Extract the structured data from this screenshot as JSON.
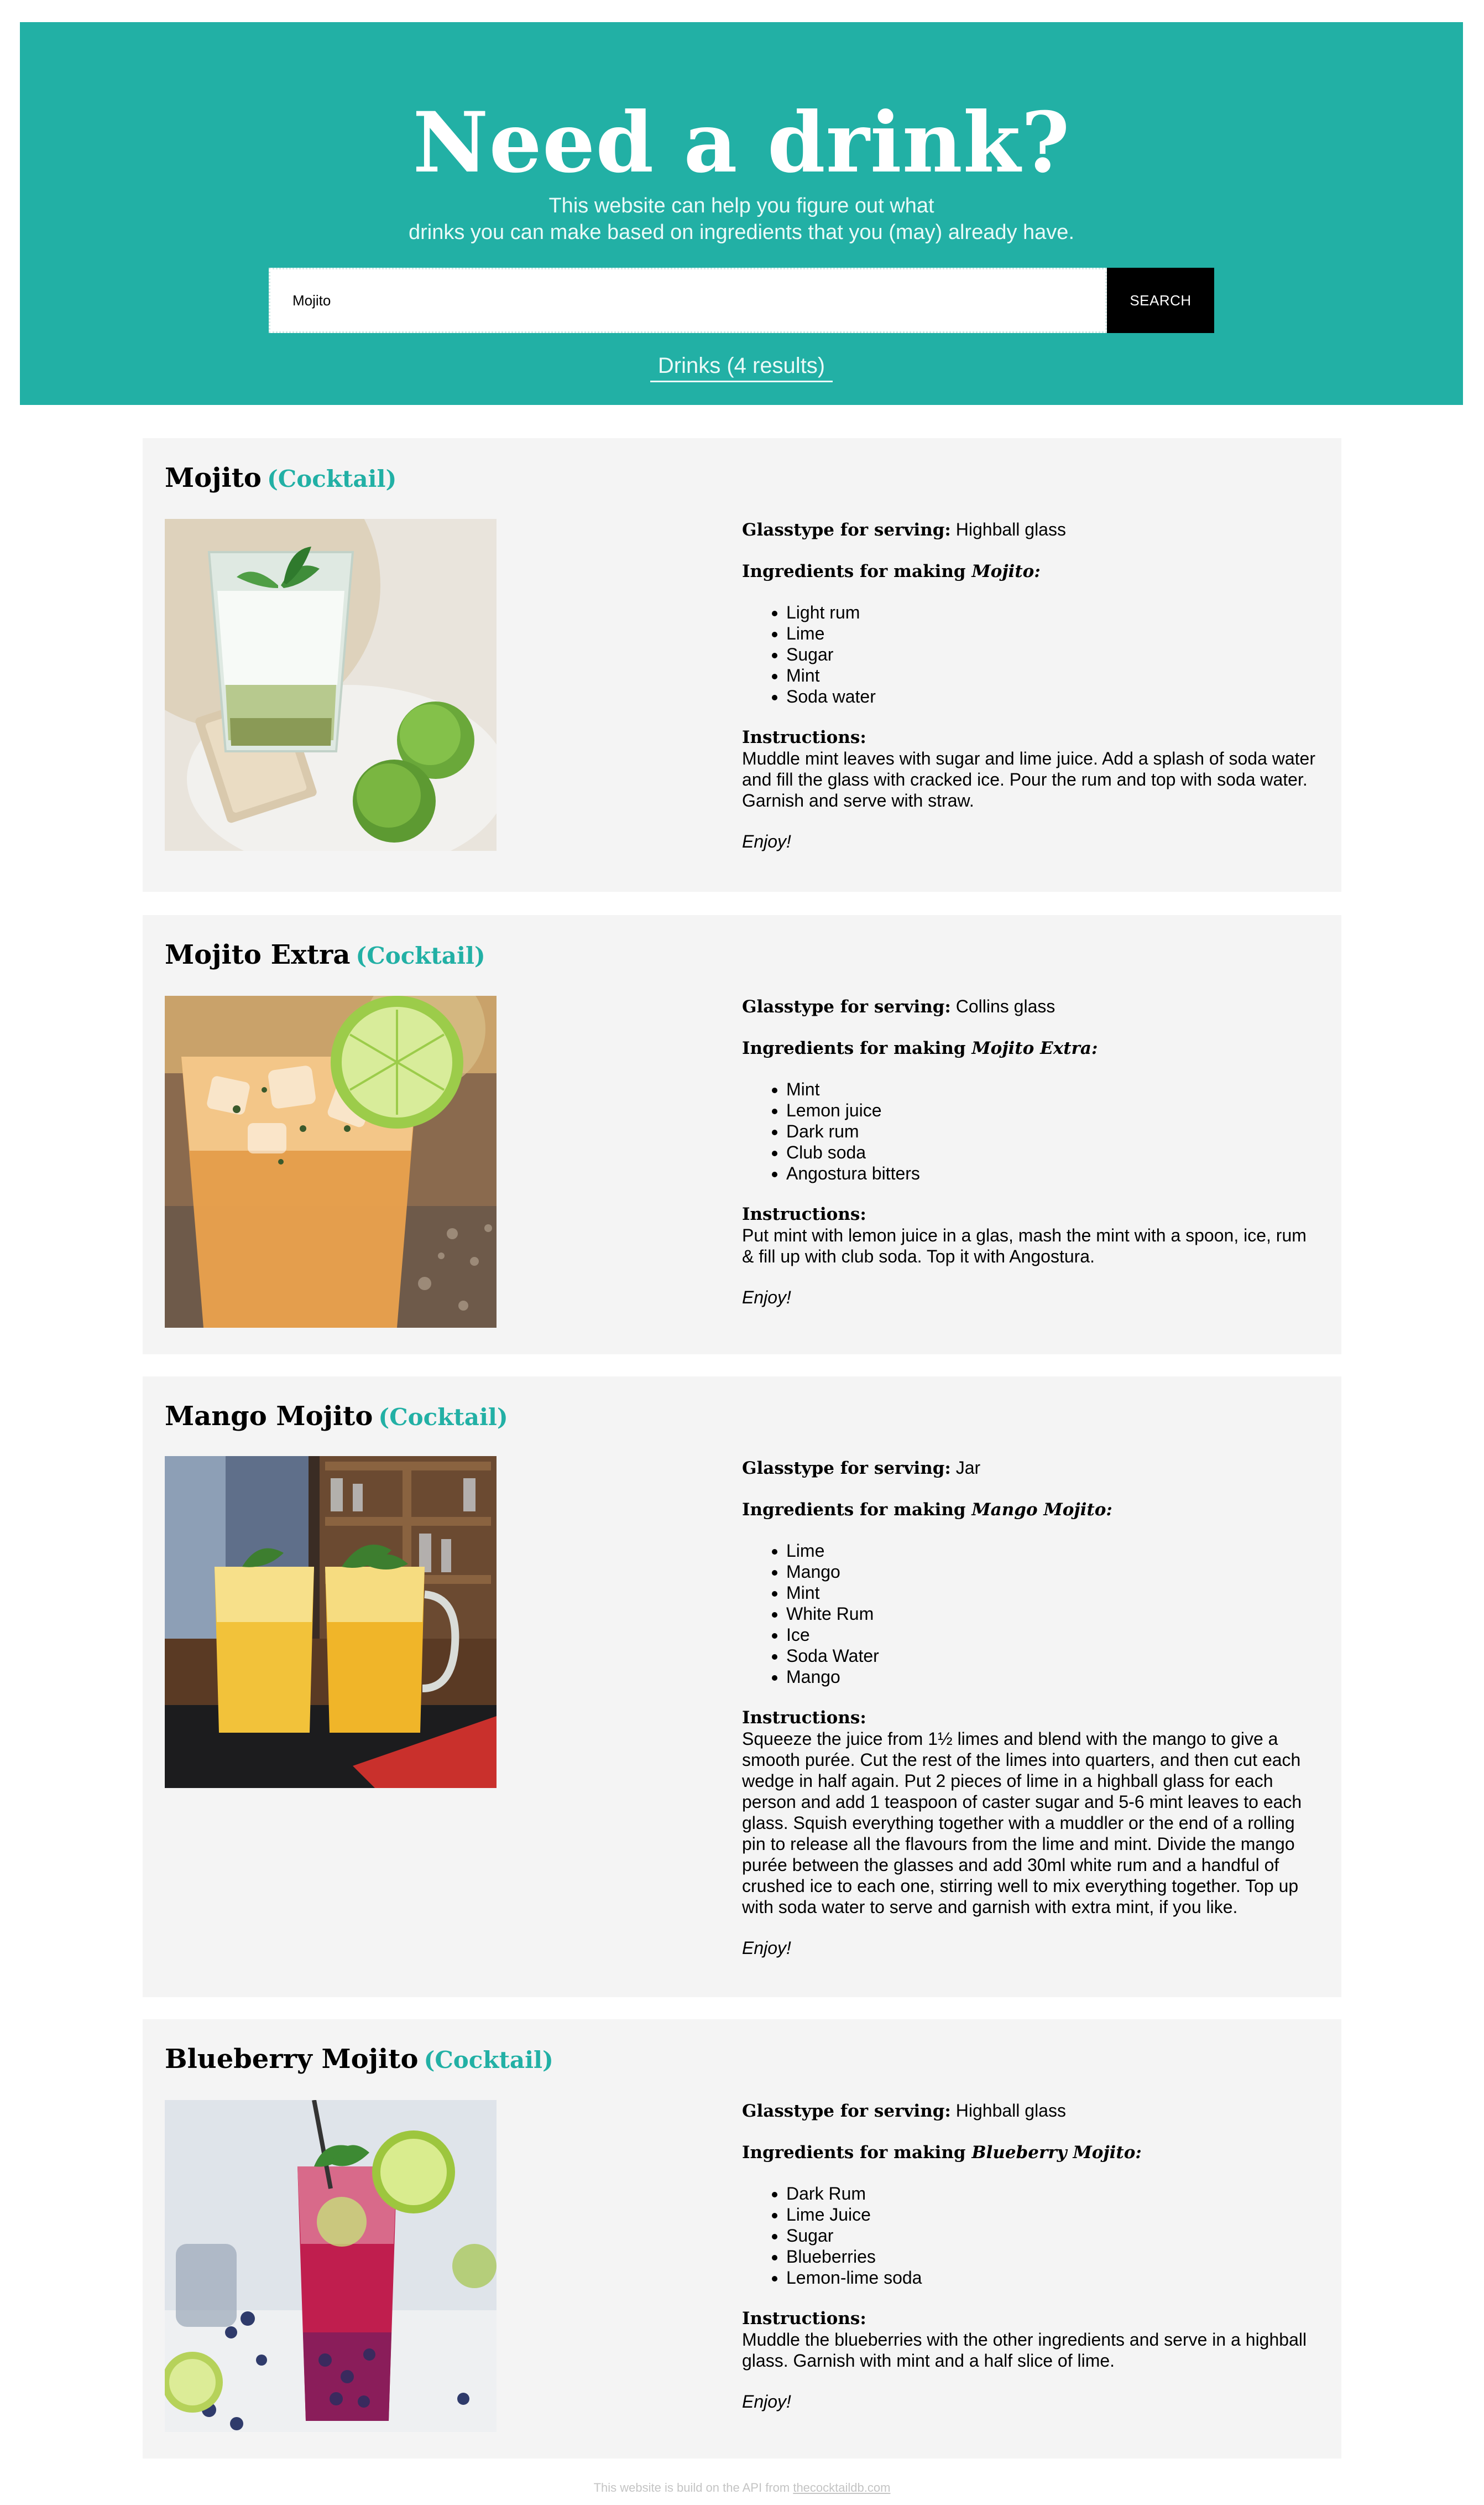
{
  "header": {
    "title": "Need a drink?",
    "subtitle_line1": "This website can help you figure out what",
    "subtitle_line2": "drinks you can make based on ingredients that you (may) already have.",
    "search_value": "Mojito",
    "search_button": "SEARCH",
    "results_label": "Drinks (4 results)"
  },
  "labels": {
    "glass": "Glasstype for serving:",
    "ingredients_prefix": "Ingredients for making",
    "instructions": "Instructions:",
    "enjoy": "Enjoy!"
  },
  "drinks": [
    {
      "name": "Mojito",
      "category": "(Cocktail)",
      "glass": "Highball glass",
      "ingredients_name": "Mojito:",
      "ingredients": [
        "Light rum",
        "Lime",
        "Sugar",
        "Mint",
        "Soda water"
      ],
      "instructions": "Muddle mint leaves with sugar and lime juice. Add a splash of soda water and fill the glass with cracked ice. Pour the rum and top with soda water. Garnish and serve with straw."
    },
    {
      "name": "Mojito Extra",
      "category": "(Cocktail)",
      "glass": "Collins glass",
      "ingredients_name": "Mojito Extra:",
      "ingredients": [
        "Mint",
        "Lemon juice",
        "Dark rum",
        "Club soda",
        "Angostura bitters"
      ],
      "instructions": "Put mint with lemon juice in a glas, mash the mint with a spoon, ice, rum & fill up with club soda. Top it with Angostura."
    },
    {
      "name": "Mango Mojito",
      "category": "(Cocktail)",
      "glass": "Jar",
      "ingredients_name": "Mango Mojito:",
      "ingredients": [
        "Lime",
        "Mango",
        "Mint",
        "White Rum",
        "Ice",
        "Soda Water",
        "Mango"
      ],
      "instructions": "Squeeze the juice from 1½ limes and blend with the mango to give a smooth purée. Cut the rest of the limes into quarters, and then cut each wedge in half again. Put 2 pieces of lime in a highball glass for each person and add 1 teaspoon of caster sugar and 5-6 mint leaves to each glass. Squish everything together with a muddler or the end of a rolling pin to release all the flavours from the lime and mint. Divide the mango purée between the glasses and add 30ml white rum and a handful of crushed ice to each one, stirring well to mix everything together. Top up with soda water to serve and garnish with extra mint, if you like."
    },
    {
      "name": "Blueberry Mojito",
      "category": "(Cocktail)",
      "glass": "Highball glass",
      "ingredients_name": "Blueberry Mojito:",
      "ingredients": [
        "Dark Rum",
        "Lime Juice",
        "Sugar",
        "Blueberries",
        "Lemon-lime soda"
      ],
      "instructions": "Muddle the blueberries with the other ingredients and serve in a highball glass. Garnish with mint and a half slice of lime."
    }
  ],
  "footer": {
    "text": "This website is build on the API from",
    "link": "thecocktaildb.com"
  },
  "colors": {
    "accent": "#22b0a5",
    "card_bg": "#f4f4f4",
    "button_bg": "#000000"
  }
}
